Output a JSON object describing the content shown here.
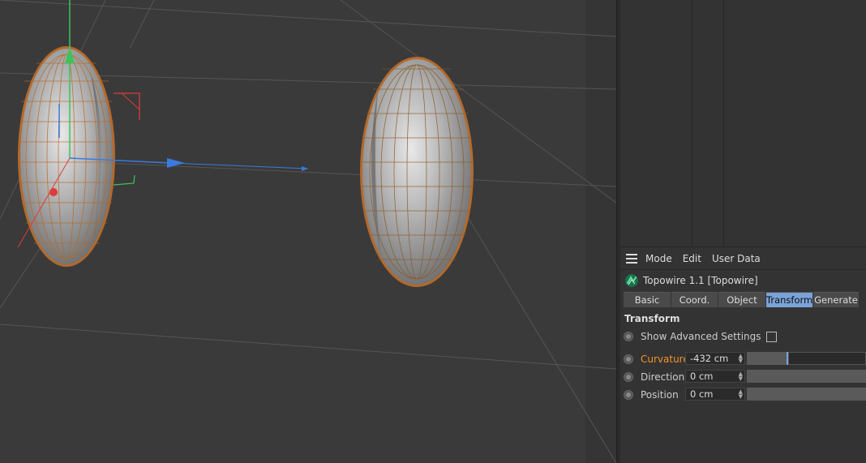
{
  "attributes": {
    "menu": [
      "Mode",
      "Edit",
      "User Data"
    ],
    "object_title": "Topowire 1.1 [Topowire]",
    "tabs": [
      "Basic",
      "Coord.",
      "Object",
      "Transform",
      "Generate"
    ],
    "active_tab": "Transform",
    "section_title": "Transform",
    "show_advanced_label": "Show Advanced Settings",
    "show_advanced_checked": false,
    "params": [
      {
        "label": "Curvature",
        "value": "-432 cm",
        "highlight": true
      },
      {
        "label": "Direction",
        "value": "0 cm",
        "highlight": false
      },
      {
        "label": "Position",
        "value": "0 cm",
        "highlight": false
      }
    ]
  },
  "colors": {
    "accent": "#7aa3d8",
    "highlight_label": "#f0942a",
    "wireframe": "#b5692a",
    "axis_x": "#e03a3a",
    "axis_y": "#3ac45a",
    "axis_z": "#3a7ae0"
  },
  "icons": {
    "menu": "hamburger-icon",
    "object": "topowire-icon"
  }
}
